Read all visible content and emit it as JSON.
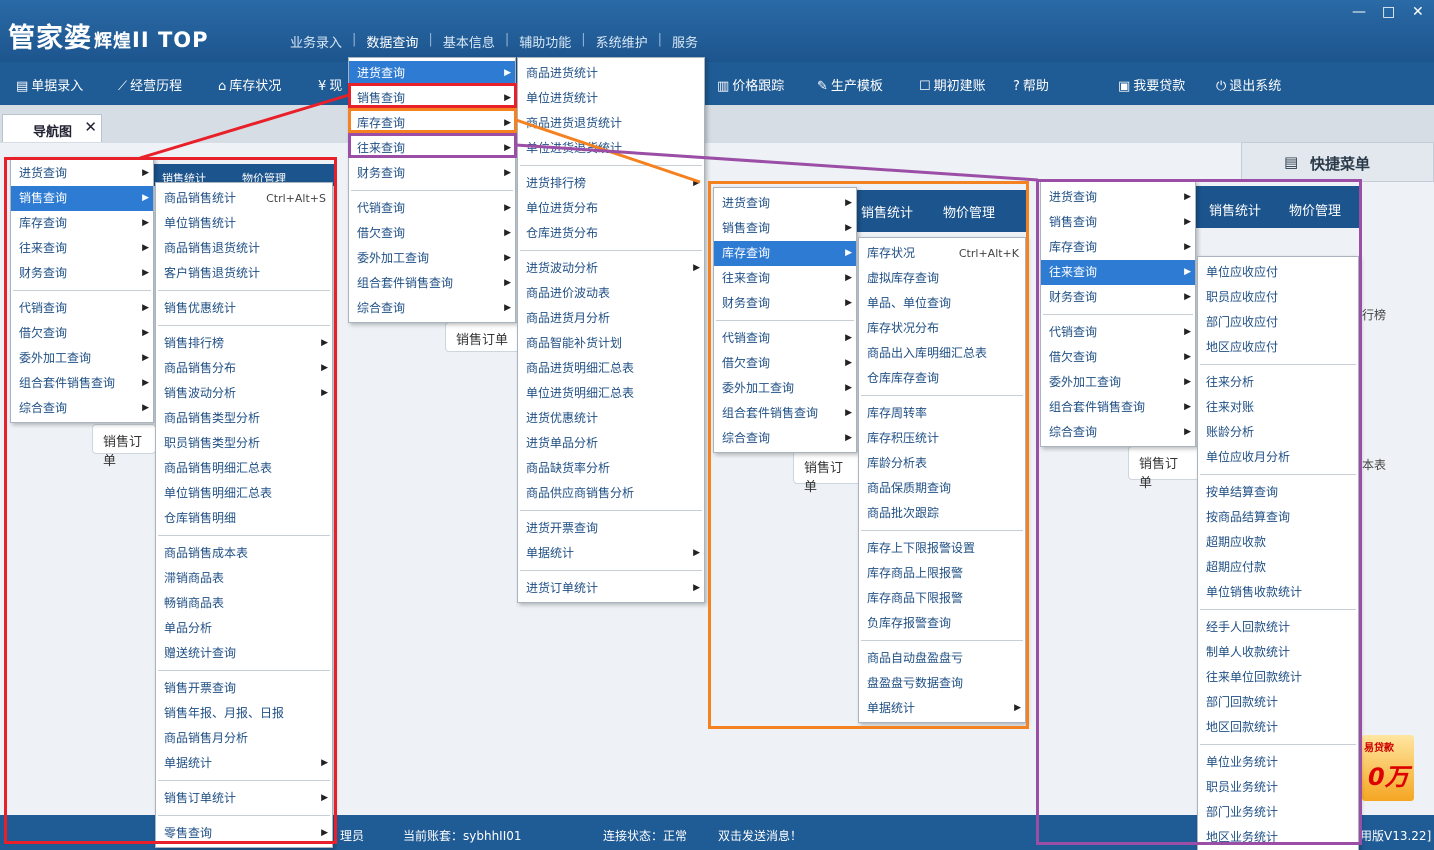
{
  "app": {
    "logo_main": "管家婆",
    "logo_sub": "辉煌",
    "logo_ver": "II TOP",
    "win_min": "—",
    "win_max": "□",
    "win_close": "✕"
  },
  "main_menu": [
    "业务录入",
    "数据查询",
    "基本信息",
    "辅助功能",
    "系统维护",
    "服务"
  ],
  "toolbar": {
    "items": [
      "单据录入",
      "经营历程",
      "库存状况",
      "现",
      "价格跟踪",
      "生产模板",
      "期初建账",
      "帮助",
      "我要贷款",
      "退出系统"
    ],
    "icons": [
      "document-icon",
      "chart-icon",
      "home-icon",
      "yen-icon",
      "bar-chart-icon",
      "wrench-icon",
      "edit-icon",
      "help-icon",
      "lock-icon",
      "power-icon"
    ]
  },
  "tabs": {
    "nav": "导航图",
    "close": "✕"
  },
  "quick_menu": "快捷菜单",
  "background": {
    "strip1": [
      "销售统计",
      "物价管理"
    ],
    "strip2": [
      "销售统计",
      "物价管理"
    ],
    "strip3": [
      "销售统计",
      "物价管理"
    ],
    "flow_labels": [
      "销售订单",
      "销售订单",
      "销售订单",
      "销售订单"
    ],
    "side_texts": [
      "行榜",
      "本表"
    ]
  },
  "status": {
    "user": "理员",
    "account": "当前账套：sybhhII01",
    "connection": "连接状态：正常",
    "message": "双击发送消息！",
    "version": "用版V13.22]"
  },
  "ad": {
    "title": "易贷款",
    "amount": "0万"
  },
  "top_menu": {
    "items": [
      "进货查询",
      "销售查询",
      "库存查询",
      "往来查询",
      "财务查询",
      "代销查询",
      "借欠查询",
      "委外加工查询",
      "组合套件销售查询",
      "综合查询"
    ],
    "active": 0
  },
  "purchase_menu": {
    "groups": [
      [
        "商品进货统计",
        "单位进货统计",
        "商品进货退货统计",
        "单位进货退货统计"
      ],
      [
        "进货排行榜",
        "单位进货分布",
        "仓库进货分布"
      ],
      [
        "进货波动分析",
        "商品进价波动表",
        "商品进货月分析",
        "商品智能补货计划",
        "商品进货明细汇总表",
        "单位进货明细汇总表",
        "进货优惠统计",
        "进货单品分析",
        "商品缺货率分析",
        "商品供应商销售分析"
      ],
      [
        "进货开票查询",
        "单据统计"
      ],
      [
        "进货订单统计"
      ]
    ],
    "arrows": [
      "进货排行榜",
      "进货波动分析",
      "单据统计",
      "进货订单统计"
    ]
  },
  "left_menu": {
    "items": [
      "进货查询",
      "销售查询",
      "库存查询",
      "往来查询",
      "财务查询",
      "代销查询",
      "借欠查询",
      "委外加工查询",
      "组合套件销售查询",
      "综合查询"
    ],
    "active": 1
  },
  "sales_menu": {
    "groups": [
      [
        "商品销售统计",
        "单位销售统计",
        "商品销售退货统计",
        "客户销售退货统计"
      ],
      [
        "销售优惠统计"
      ],
      [
        "销售排行榜",
        "商品销售分布",
        "销售波动分析",
        "商品销售类型分析",
        "职员销售类型分析",
        "商品销售明细汇总表",
        "单位销售明细汇总表",
        "仓库销售明细"
      ],
      [
        "商品销售成本表",
        "滞销商品表",
        "畅销商品表",
        "单品分析",
        "赠送统计查询"
      ],
      [
        "销售开票查询",
        "销售年报、月报、日报",
        "商品销售月分析",
        "单据统计"
      ],
      [
        "销售订单统计"
      ],
      [
        "零售查询"
      ]
    ],
    "shortcut": "Ctrl+Alt+S",
    "arrows": [
      "销售排行榜",
      "商品销售分布",
      "销售波动分析",
      "单据统计",
      "销售订单统计",
      "零售查询"
    ]
  },
  "middle_menu": {
    "items": [
      "进货查询",
      "销售查询",
      "库存查询",
      "往来查询",
      "财务查询",
      "代销查询",
      "借欠查询",
      "委外加工查询",
      "组合套件销售查询",
      "综合查询"
    ],
    "active": 2
  },
  "stock_menu": {
    "groups": [
      [
        "库存状况",
        "虚拟库存查询",
        "单品、单位查询",
        "库存状况分布",
        "商品出入库明细汇总表",
        "仓库库存查询"
      ],
      [
        "库存周转率",
        "库存积压统计",
        "库龄分析表",
        "商品保质期查询",
        "商品批次跟踪"
      ],
      [
        "库存上下限报警设置",
        "库存商品上限报警",
        "库存商品下限报警",
        "负库存报警查询"
      ],
      [
        "商品自动盘盈盘亏",
        "盘盈盘亏数据查询",
        "单据统计"
      ]
    ],
    "shortcut": "Ctrl+Alt+K",
    "arrows": [
      "单据统计"
    ]
  },
  "right_menu": {
    "items": [
      "进货查询",
      "销售查询",
      "库存查询",
      "往来查询",
      "财务查询",
      "代销查询",
      "借欠查询",
      "委外加工查询",
      "组合套件销售查询",
      "综合查询"
    ],
    "active": 3
  },
  "account_menu": {
    "groups": [
      [
        "单位应收应付",
        "职员应收应付",
        "部门应收应付",
        "地区应收应付"
      ],
      [
        "往来分析",
        "往来对账",
        "账龄分析",
        "单位应收月分析"
      ],
      [
        "按单结算查询",
        "按商品结算查询",
        "超期应收款",
        "超期应付款",
        "单位销售收款统计"
      ],
      [
        "经手人回款统计",
        "制单人收款统计",
        "往来单位回款统计",
        "部门回款统计",
        "地区回款统计"
      ],
      [
        "单位业务统计",
        "职员业务统计",
        "部门业务统计",
        "地区业务统计"
      ]
    ]
  },
  "highlight_colors": {
    "red": "#e8202a",
    "orange": "#f58220",
    "purple": "#9b4ea6"
  }
}
